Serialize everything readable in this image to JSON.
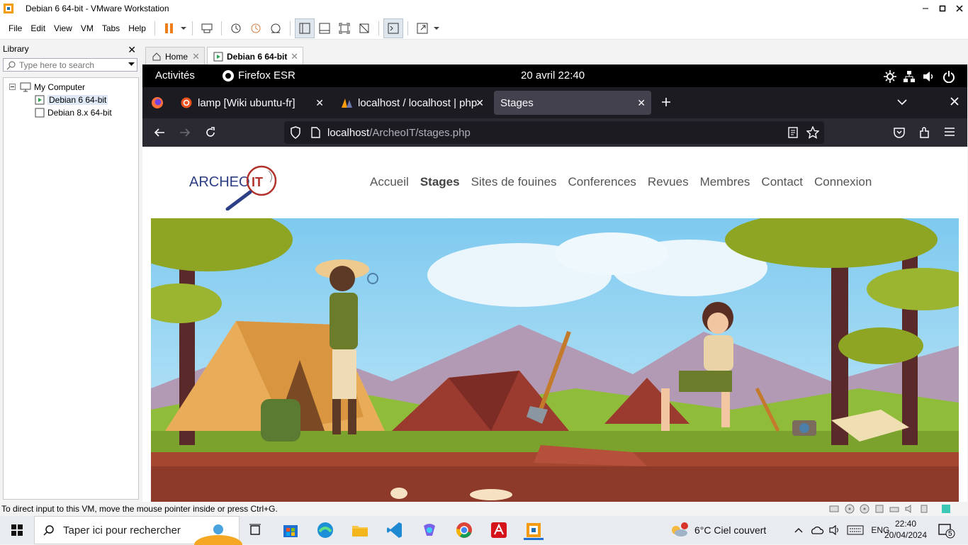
{
  "window": {
    "title": "Debian 6 64-bit - VMware Workstation"
  },
  "menu": [
    "File",
    "Edit",
    "View",
    "VM",
    "Tabs",
    "Help"
  ],
  "library": {
    "title": "Library",
    "search_placeholder": "Type here to search",
    "root": "My Computer",
    "items": [
      "Debian 6 64-bit",
      "Debian 8.x 64-bit"
    ]
  },
  "vm_tabs": [
    {
      "label": "Home"
    },
    {
      "label": "Debian 6 64-bit"
    }
  ],
  "gnome": {
    "activities": "Activités",
    "app": "Firefox ESR",
    "clock": "20 avril  22:40"
  },
  "firefox": {
    "tabs": [
      {
        "label": "lamp [Wiki ubuntu-fr]"
      },
      {
        "label": "localhost / localhost | php"
      },
      {
        "label": "Stages"
      }
    ],
    "url_host": "localhost",
    "url_path": "/ArcheoIT/stages.php"
  },
  "site": {
    "logo_text": "ARCHEO",
    "logo_it": "IT",
    "nav": [
      {
        "label": "Accueil",
        "active": false
      },
      {
        "label": "Stages",
        "active": true
      },
      {
        "label": "Sites de fouines",
        "active": false
      },
      {
        "label": "Conferences",
        "active": false
      },
      {
        "label": "Revues",
        "active": false
      },
      {
        "label": "Membres",
        "active": false
      },
      {
        "label": "Contact",
        "active": false
      },
      {
        "label": "Connexion",
        "active": false
      }
    ]
  },
  "status": {
    "hint": "To direct input to this VM, move the mouse pointer inside or press Ctrl+G."
  },
  "taskbar": {
    "search_placeholder": "Taper ici pour rechercher",
    "weather": "6°C  Ciel couvert",
    "lang": "ENG",
    "time": "22:40",
    "date": "20/04/2024",
    "notifications": "5"
  },
  "colors": {
    "gnome_bar": "#000000",
    "ff_tabs": "#1c1b22",
    "ff_nav": "#2b2a33",
    "accent": "#0a84ff"
  }
}
